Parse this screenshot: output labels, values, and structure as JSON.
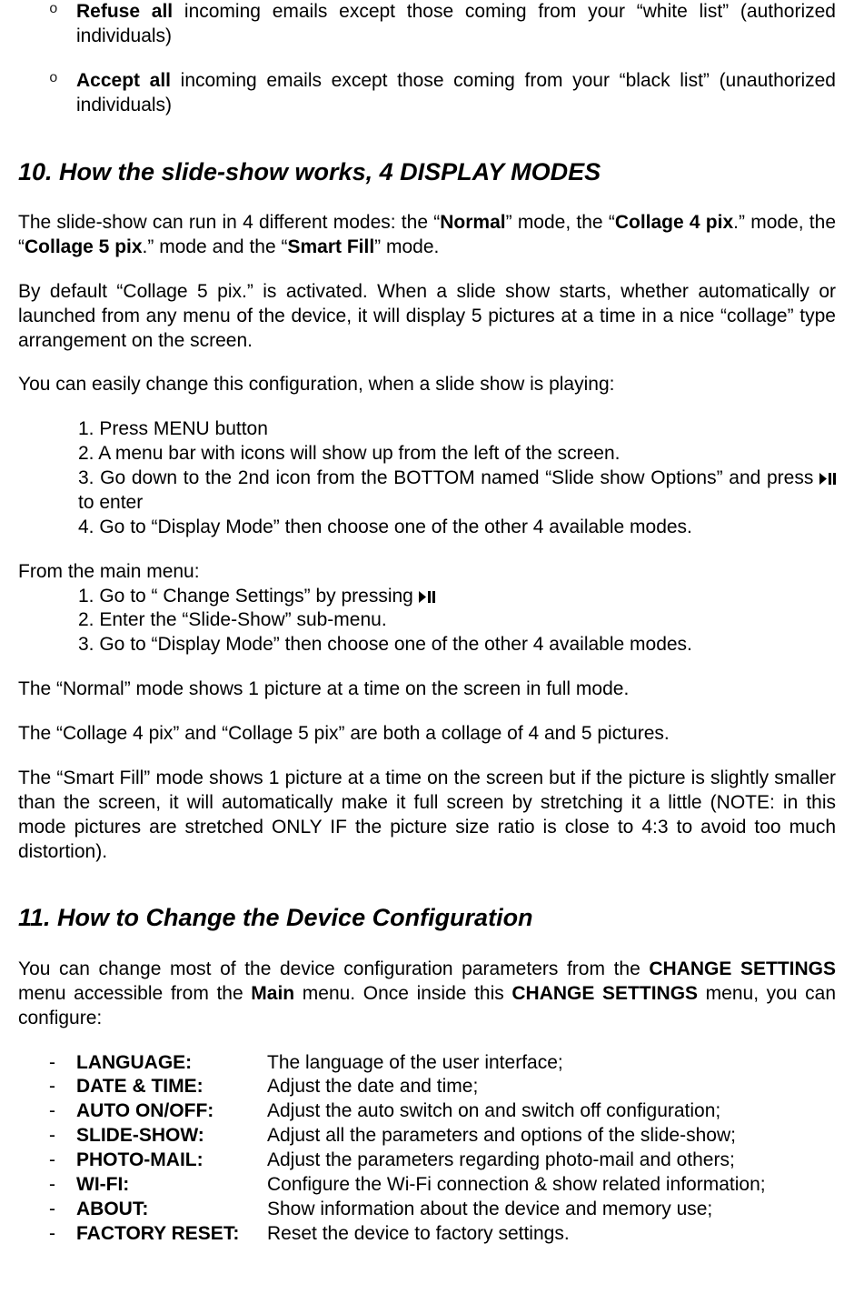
{
  "intro_bullets": [
    {
      "bold": "Refuse all",
      "rest": " incoming emails except those coming from your “white list” (authorized individuals)"
    },
    {
      "bold": "Accept all",
      "rest": " incoming emails except those coming from your “black list” (unauthorized individuals)"
    }
  ],
  "section10": {
    "title": "10. How the slide-show works, 4 DISPLAY MODES",
    "p1_a": "The slide-show can run in 4 different modes: the “",
    "p1_b": "Normal",
    "p1_c": "” mode, the “",
    "p1_d": "Collage 4 pix",
    "p1_e": ".” mode, the “",
    "p1_f": "Collage 5 pix",
    "p1_g": ".” mode and the “",
    "p1_h": "Smart Fill",
    "p1_i": "” mode.",
    "p2": "By default “Collage 5 pix.” is activated. When a slide show starts, whether automatically or launched from any menu of the device, it will display 5 pictures at a time in a nice “collage” type arrangement on the screen.",
    "p3": "You can easily change this configuration, when a slide show is playing:",
    "stepsA": {
      "s1": "1. Press MENU button",
      "s2": "2. A menu bar with icons will show up from the left of the screen.",
      "s3a": "3. Go down to the 2nd icon from the BOTTOM named “Slide show Options” and press ",
      "s3b": " to enter",
      "s4": "4. Go to “Display Mode” then choose one of the other 4 available modes."
    },
    "fromMain": "From the main menu:",
    "stepsB": {
      "s1a": "1. Go to “ Change Settings” by pressing ",
      "s2": "2. Enter the “Slide-Show” sub-menu.",
      "s3": "3. Go to “Display Mode” then choose one of the other 4 available modes."
    },
    "p_normal": "The “Normal” mode shows 1 picture at a time on the screen in full mode.",
    "p_collage": "The “Collage 4 pix” and “Collage 5 pix” are both a collage of 4 and 5 pictures.",
    "p_smartfill": "The “Smart Fill” mode shows 1 picture at a time on the screen but if the picture is slightly smaller than the screen, it will automatically make it full screen by stretching it a little (NOTE: in this mode pictures are stretched ONLY IF the picture size ratio is close to 4:3 to avoid too much distortion)."
  },
  "section11": {
    "title": "11. How to Change the Device Configuration",
    "intro_a": "You can change most of the device configuration parameters from the ",
    "intro_b": "CHANGE SETTINGS",
    "intro_c": " menu accessible from the ",
    "intro_d": "Main",
    "intro_e": " menu. Once inside this ",
    "intro_f": "CHANGE SETTINGS",
    "intro_g": " menu, you can configure:",
    "items": [
      {
        "label": "LANGUAGE:",
        "desc": "The language of the user interface;"
      },
      {
        "label": "DATE & TIME:",
        "desc": "Adjust the date and time;"
      },
      {
        "label": "AUTO ON/OFF:",
        "desc": "Adjust the auto switch on and switch off configuration;"
      },
      {
        "label": "SLIDE-SHOW:",
        "desc": "Adjust all the parameters and options of the slide-show;"
      },
      {
        "label": "PHOTO-MAIL:",
        "desc": "Adjust the parameters regarding photo-mail and others;"
      },
      {
        "label": "WI-FI:",
        "desc": "Configure the Wi-Fi connection & show related information;"
      },
      {
        "label": "ABOUT:",
        "desc": "Show information about the device and memory use;"
      },
      {
        "label": "FACTORY RESET:",
        "desc": "Reset the device to factory settings."
      }
    ]
  }
}
